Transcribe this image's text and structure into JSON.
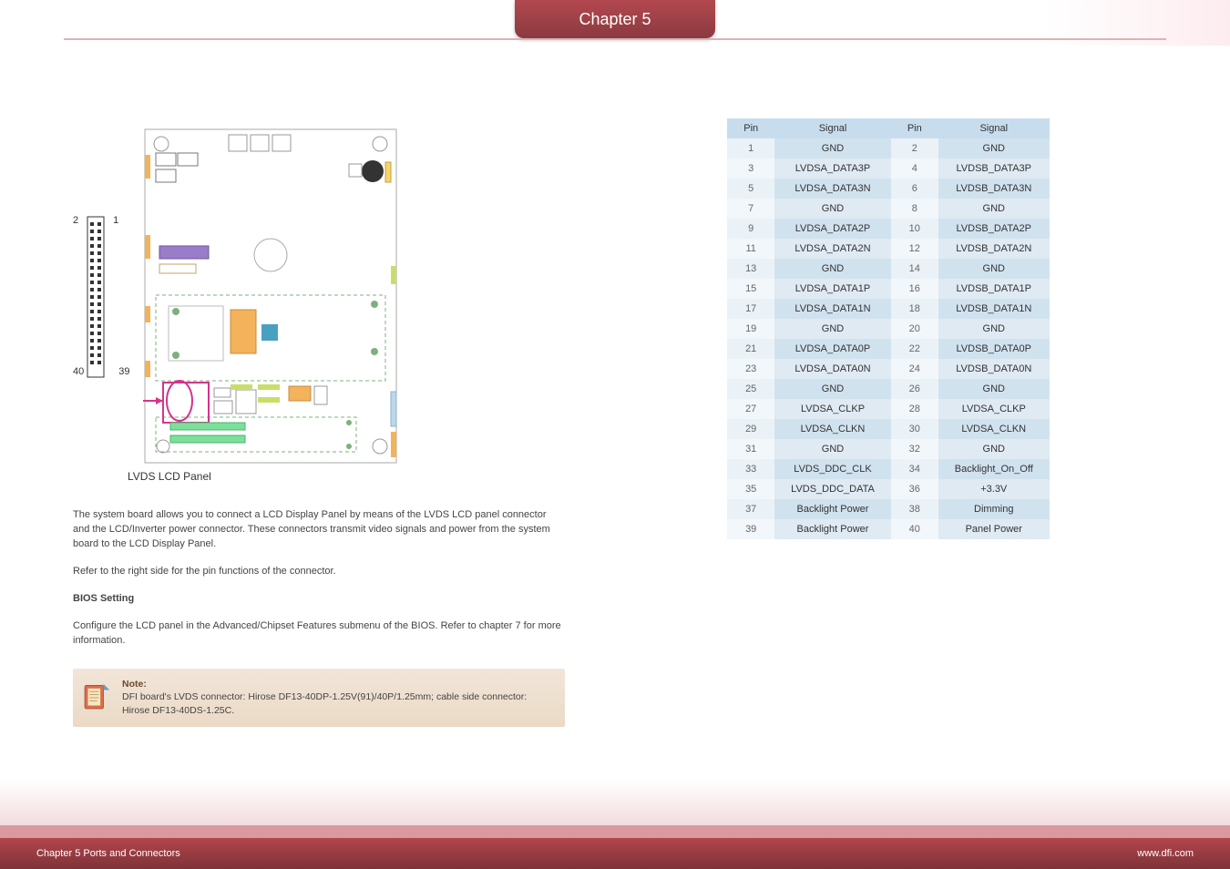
{
  "chapter_tab": "Chapter 5",
  "diagram": {
    "pin_tl": "2",
    "pin_tr": "1",
    "pin_bl": "40",
    "pin_br": "39",
    "caption": "LVDS LCD Panel"
  },
  "paragraphs": {
    "p1": "The system board allows you to connect a LCD Display Panel by means of the LVDS LCD panel connector and the LCD/Inverter power connector. These connectors transmit video signals and power from the system board to the LCD Display Panel.",
    "p2": "Refer to the right side for the pin functions of the connector.",
    "heading": "BIOS Setting",
    "p3": "Configure the LCD panel in the Advanced/Chipset Features submenu of the BIOS. Refer to chapter 7 for more information."
  },
  "note": {
    "title": "Note:",
    "text": "DFI board's LVDS connector: Hirose DF13-40DP-1.25V(91)/40P/1.25mm; cable side connector: Hirose DF13-40DS-1.25C."
  },
  "table": {
    "headers": [
      "Pin",
      "Signal",
      "Pin",
      "Signal"
    ],
    "rows": [
      [
        "1",
        "GND",
        "2",
        "GND"
      ],
      [
        "3",
        "LVDSA_DATA3P",
        "4",
        "LVDSB_DATA3P"
      ],
      [
        "5",
        "LVDSA_DATA3N",
        "6",
        "LVDSB_DATA3N"
      ],
      [
        "7",
        "GND",
        "8",
        "GND"
      ],
      [
        "9",
        "LVDSA_DATA2P",
        "10",
        "LVDSB_DATA2P"
      ],
      [
        "11",
        "LVDSA_DATA2N",
        "12",
        "LVDSB_DATA2N"
      ],
      [
        "13",
        "GND",
        "14",
        "GND"
      ],
      [
        "15",
        "LVDSA_DATA1P",
        "16",
        "LVDSB_DATA1P"
      ],
      [
        "17",
        "LVDSA_DATA1N",
        "18",
        "LVDSB_DATA1N"
      ],
      [
        "19",
        "GND",
        "20",
        "GND"
      ],
      [
        "21",
        "LVDSA_DATA0P",
        "22",
        "LVDSB_DATA0P"
      ],
      [
        "23",
        "LVDSA_DATA0N",
        "24",
        "LVDSB_DATA0N"
      ],
      [
        "25",
        "GND",
        "26",
        "GND"
      ],
      [
        "27",
        "LVDSA_CLKP",
        "28",
        "LVDSA_CLKP"
      ],
      [
        "29",
        "LVDSA_CLKN",
        "30",
        "LVDSA_CLKN"
      ],
      [
        "31",
        "GND",
        "32",
        "GND"
      ],
      [
        "33",
        "LVDS_DDC_CLK",
        "34",
        "Backlight_On_Off"
      ],
      [
        "35",
        "LVDS_DDC_DATA",
        "36",
        "+3.3V"
      ],
      [
        "37",
        "Backlight Power",
        "38",
        "Dimming"
      ],
      [
        "39",
        "Backlight Power",
        "40",
        "Panel Power"
      ]
    ]
  },
  "footer": {
    "left": "Chapter 5 Ports and Connectors",
    "right": "www.dfi.com"
  }
}
